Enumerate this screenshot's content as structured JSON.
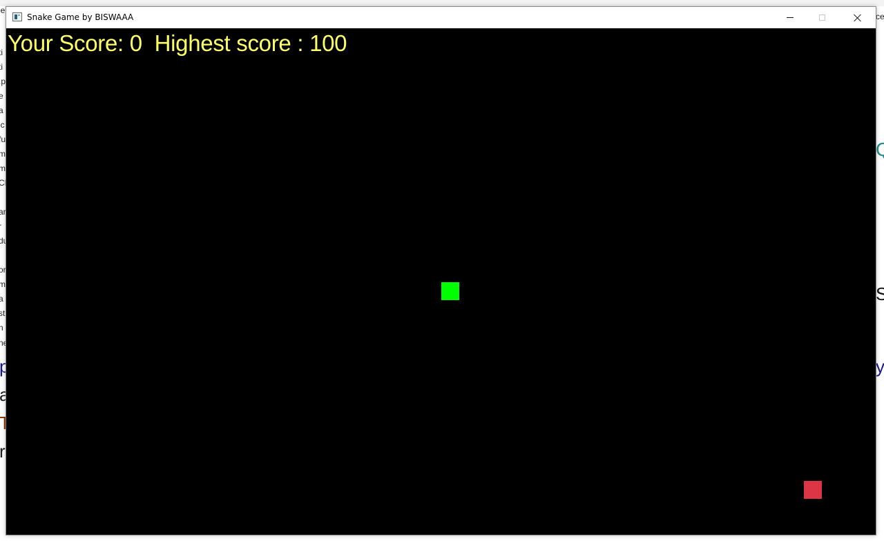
{
  "window": {
    "title": "Snake Game by BISWAAA",
    "controls": {
      "minimize_icon": "minimize-icon",
      "maximize_icon": "maximize-icon",
      "close_icon": "close-icon"
    }
  },
  "game": {
    "score_label": "Your Score: ",
    "score_value": "0",
    "highscore_label": "  Highest score : ",
    "highscore_value": "100",
    "colors": {
      "background": "#000000",
      "score_text": "#ffff66",
      "snake": "#00ff00",
      "food": "#dc3545"
    }
  },
  "background_app": {
    "left_fragments": [
      "le",
      "ti",
      "ti",
      ".p",
      "e",
      "a",
      "ic",
      "fu",
      "m",
      "m",
      "CE",
      "ar",
      "r",
      "du",
      "or",
      "m",
      "a",
      "st",
      "n",
      "ne",
      "p",
      "a",
      "T",
      "r"
    ],
    "right_fragments": [
      "ce_",
      "Q",
      "S",
      "y"
    ]
  }
}
